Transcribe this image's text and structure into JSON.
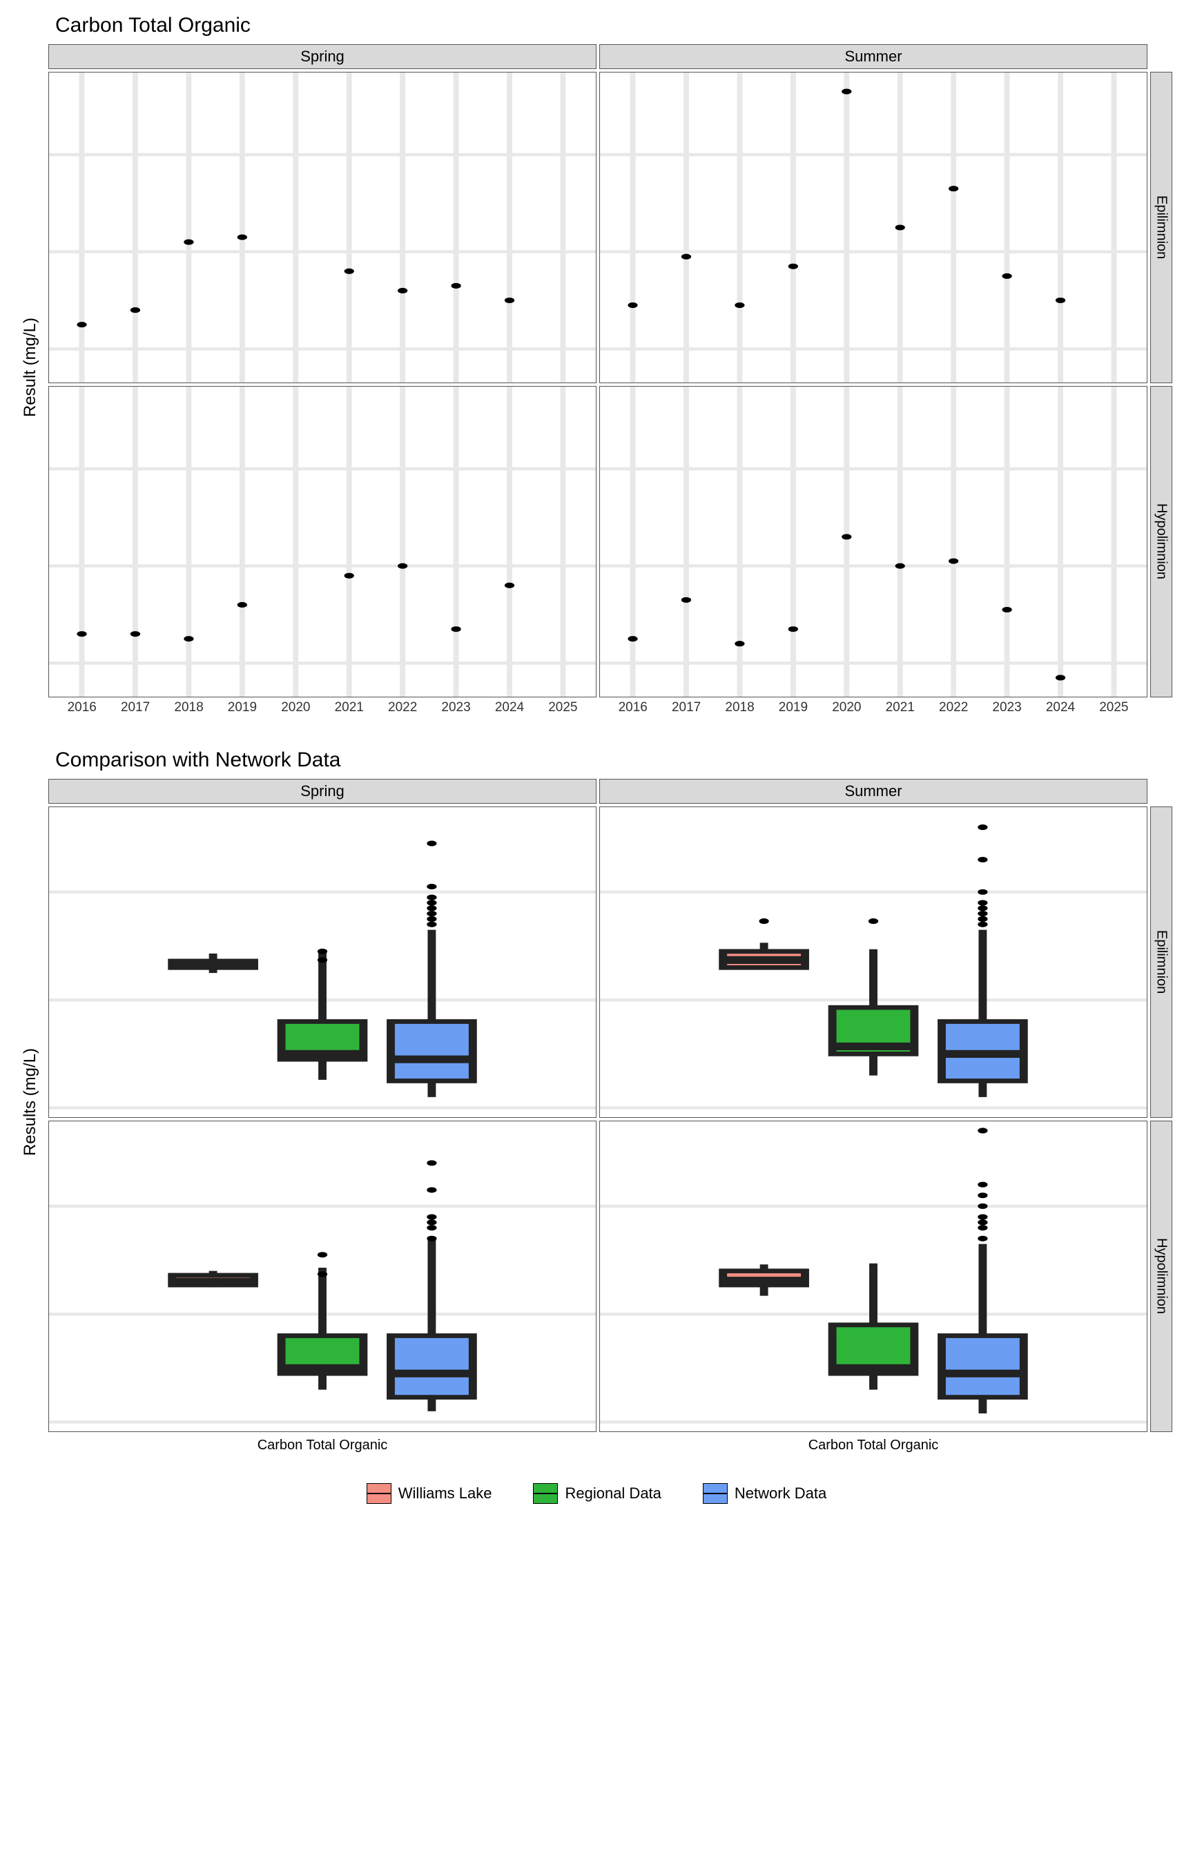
{
  "chart_data": [
    {
      "type": "scatter",
      "title": "Carbon Total Organic",
      "ylabel": "Result (mg/L)",
      "x": [
        2016,
        2017,
        2018,
        2019,
        2020,
        2021,
        2022,
        2023,
        2024,
        2025
      ],
      "ylim": [
        11.5,
        17.5
      ],
      "yticks": [
        12,
        14,
        16
      ],
      "facets": {
        "cols": [
          "Spring",
          "Summer"
        ],
        "rows": [
          "Epilimnion",
          "Hypolimnion"
        ]
      },
      "panels": {
        "Spring|Epilimnion": [
          [
            2016,
            12.5
          ],
          [
            2017,
            12.8
          ],
          [
            2018,
            14.2
          ],
          [
            2019,
            14.3
          ],
          [
            2021,
            13.6
          ],
          [
            2022,
            13.2
          ],
          [
            2023,
            13.3
          ],
          [
            2024,
            13.0
          ]
        ],
        "Summer|Epilimnion": [
          [
            2016,
            12.9
          ],
          [
            2017,
            13.9
          ],
          [
            2018,
            12.9
          ],
          [
            2019,
            13.7
          ],
          [
            2020,
            17.3
          ],
          [
            2021,
            14.5
          ],
          [
            2022,
            15.3
          ],
          [
            2023,
            13.5
          ],
          [
            2024,
            13.0
          ]
        ],
        "Spring|Hypolimnion": [
          [
            2016,
            12.6
          ],
          [
            2017,
            12.6
          ],
          [
            2018,
            12.5
          ],
          [
            2019,
            13.2
          ],
          [
            2021,
            13.8
          ],
          [
            2022,
            14.0
          ],
          [
            2023,
            12.7
          ],
          [
            2024,
            13.6
          ]
        ],
        "Summer|Hypolimnion": [
          [
            2016,
            12.5
          ],
          [
            2017,
            13.3
          ],
          [
            2018,
            12.4
          ],
          [
            2019,
            12.7
          ],
          [
            2020,
            14.6
          ],
          [
            2021,
            14.0
          ],
          [
            2022,
            14.1
          ],
          [
            2023,
            13.1
          ],
          [
            2024,
            11.7
          ]
        ]
      }
    },
    {
      "type": "box",
      "title": "Comparison with Network Data",
      "ylabel": "Results (mg/L)",
      "xlabel": "Carbon Total Organic",
      "ylim": [
        0,
        27
      ],
      "yticks": [
        0,
        10,
        20
      ],
      "facets": {
        "cols": [
          "Spring",
          "Summer"
        ],
        "rows": [
          "Epilimnion",
          "Hypolimnion"
        ]
      },
      "series": [
        {
          "name": "Williams Lake",
          "color": "#f28e82"
        },
        {
          "name": "Regional Data",
          "color": "#2fb43a"
        },
        {
          "name": "Network Data",
          "color": "#6b9ef2"
        }
      ],
      "panels": {
        "Spring|Epilimnion": {
          "Williams Lake": {
            "min": 12.5,
            "q1": 13.0,
            "med": 13.2,
            "q3": 13.6,
            "max": 14.3,
            "out": []
          },
          "Regional Data": {
            "min": 2.6,
            "q1": 4.5,
            "med": 5.0,
            "q3": 8.0,
            "max": 14.5,
            "out": [
              13.7,
              14.5
            ]
          },
          "Network Data": {
            "min": 1.0,
            "q1": 2.5,
            "med": 4.5,
            "q3": 8.0,
            "max": 16.5,
            "out": [
              17,
              17.5,
              18,
              18.5,
              19,
              19.5,
              20.5,
              24.5
            ]
          }
        },
        "Summer|Epilimnion": {
          "Williams Lake": {
            "min": 12.9,
            "q1": 13.0,
            "med": 13.7,
            "q3": 14.5,
            "max": 15.3,
            "out": [
              17.3
            ]
          },
          "Regional Data": {
            "min": 3.0,
            "q1": 5.0,
            "med": 5.7,
            "q3": 9.3,
            "max": 14.7,
            "out": [
              17.3
            ]
          },
          "Network Data": {
            "min": 1.0,
            "q1": 2.5,
            "med": 5.0,
            "q3": 8.0,
            "max": 16.5,
            "out": [
              17,
              17.5,
              18,
              18.5,
              19,
              20,
              23,
              26
            ]
          }
        },
        "Spring|Hypolimnion": {
          "Williams Lake": {
            "min": 12.5,
            "q1": 12.7,
            "med": 13.0,
            "q3": 13.6,
            "max": 14.0,
            "out": []
          },
          "Regional Data": {
            "min": 3.0,
            "q1": 4.5,
            "med": 5.0,
            "q3": 8.0,
            "max": 14.3,
            "out": [
              15.5,
              13.7
            ]
          },
          "Network Data": {
            "min": 1.0,
            "q1": 2.3,
            "med": 4.5,
            "q3": 8.0,
            "max": 17.0,
            "out": [
              17,
              18,
              18.5,
              19,
              21.5,
              24
            ]
          }
        },
        "Summer|Hypolimnion": {
          "Williams Lake": {
            "min": 11.7,
            "q1": 12.7,
            "med": 13.1,
            "q3": 14.0,
            "max": 14.6,
            "out": []
          },
          "Regional Data": {
            "min": 3.0,
            "q1": 4.5,
            "med": 5.0,
            "q3": 9.0,
            "max": 14.7,
            "out": []
          },
          "Network Data": {
            "min": 0.8,
            "q1": 2.3,
            "med": 4.5,
            "q3": 8.0,
            "max": 16.5,
            "out": [
              17,
              18,
              18.5,
              19,
              20,
              21,
              22,
              27
            ]
          }
        }
      }
    }
  ],
  "legend": {
    "items": [
      "Williams Lake",
      "Regional Data",
      "Network Data"
    ],
    "colors": [
      "#f28e82",
      "#2fb43a",
      "#6b9ef2"
    ]
  }
}
